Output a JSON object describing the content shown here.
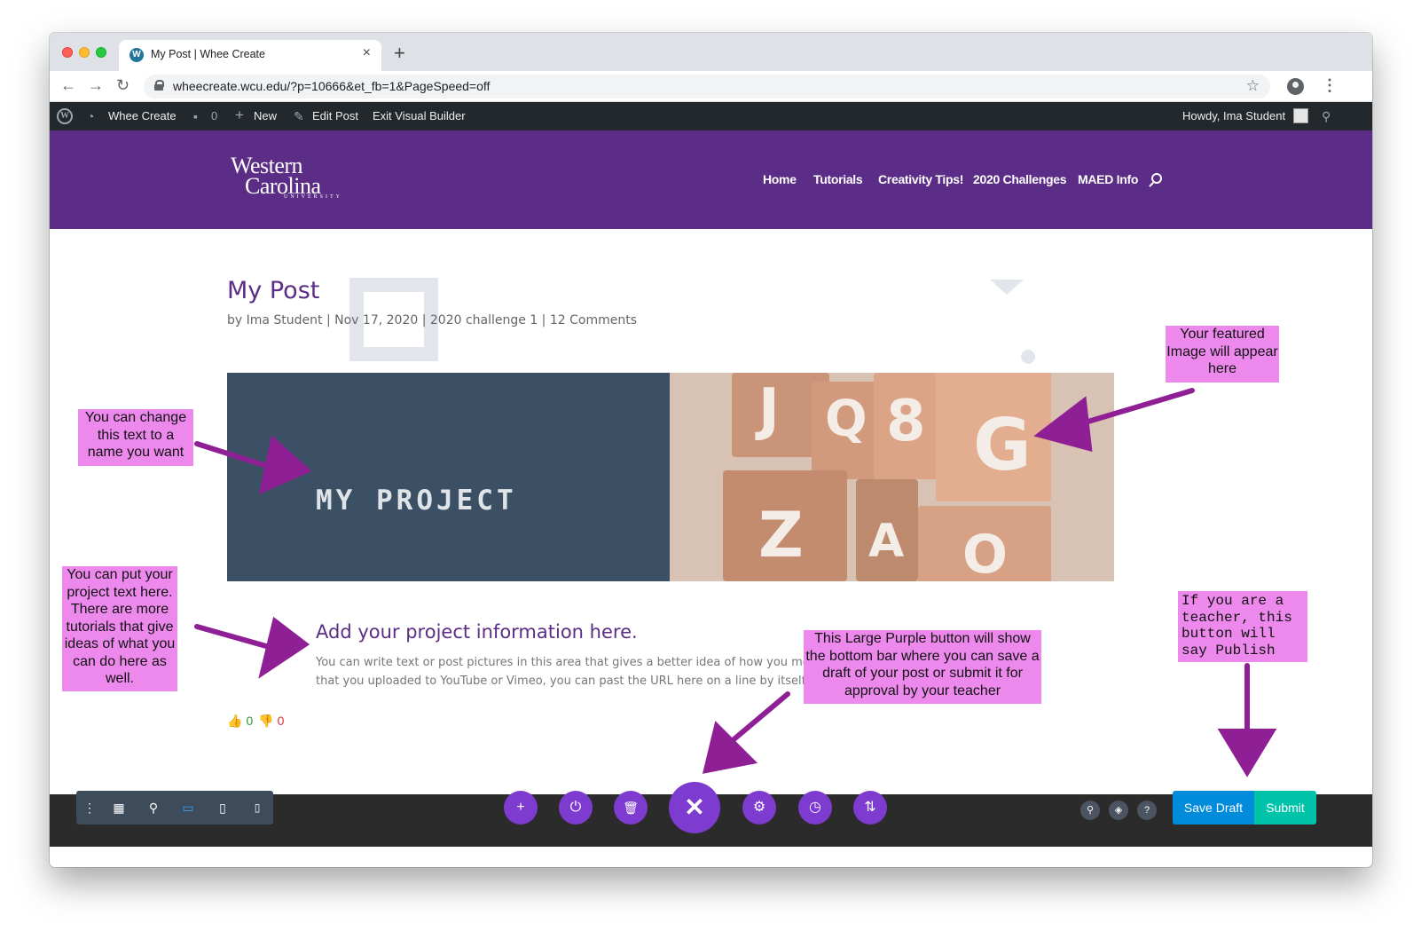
{
  "browser": {
    "tab_title": "My Post | Whee Create",
    "tab_favicon": "W",
    "tab_close": "×",
    "new_tab": "+",
    "url": "wheecreate.wcu.edu/?p=10666&et_fb=1&PageSpeed=off",
    "back": "←",
    "forward": "→",
    "reload": "↻",
    "star": "☆",
    "menu": "⋮"
  },
  "adminbar": {
    "wp_logo": "W",
    "site_name": "Whee Create",
    "comments_icon": "comment-icon",
    "comments_count": "0",
    "new_label": "New",
    "edit_post_label": "Edit Post",
    "exit_label": "Exit Visual Builder",
    "howdy": "Howdy, Ima Student",
    "search_glyph": "⚲",
    "pencil_glyph": "✎",
    "plus_glyph": "+",
    "speech_glyph": "▪",
    "gauge_glyph": "◔"
  },
  "site": {
    "logo_line1": "Western",
    "logo_line2": "Carolina",
    "logo_line3": "UNIVERSITY",
    "menu": [
      "Home",
      "Tutorials",
      "Creativity Tips!",
      "2020 Challenges",
      "MAED Info"
    ],
    "brand_color": "#5b2d86"
  },
  "post": {
    "title": "My Post",
    "meta": "by Ima Student | Nov 17, 2020 | 2020 challenge 1 | 12 Comments",
    "hero_text": "MY PROJECT",
    "hero_letters": [
      "J",
      "Q",
      "8",
      "G",
      "Z",
      "A",
      "O"
    ],
    "section_title": "Add your project information here.",
    "section_body_line1": "You can write text or post pictures in this area that gives a better idea of how you met t",
    "section_body_line2": "that you uploaded to YouTube or Vimeo, you can past the URL here on a line by itself a",
    "like_glyph": "👍",
    "dislike_glyph": "👎",
    "likes": "0",
    "dislikes": "0"
  },
  "builder": {
    "left_tools": [
      "⋮",
      "▦",
      "⚲",
      "▭",
      "▯",
      "▯"
    ],
    "center_buttons": [
      "+",
      "⏻",
      "🗑",
      "⚙",
      "◷",
      "⇅"
    ],
    "close_glyph": "✕",
    "right_buttons": [
      "⚲",
      "◈",
      "?"
    ],
    "save_draft": "Save Draft",
    "submit": "Submit"
  },
  "annotations": {
    "featured": "Your featured Image will appear here",
    "change_text": "You can change this text to a name you want",
    "project_text": "You can put your project text here. There are more tutorials that give ideas of what you can do here as well.",
    "purple_button": "This Large Purple button will show the bottom bar where you can save a draft of your post or submit it for approval by your teacher",
    "teacher": "If you are a teacher, this button will say Publish",
    "arrow_color": "#8e1f94",
    "note_color": "#ed89ed"
  }
}
